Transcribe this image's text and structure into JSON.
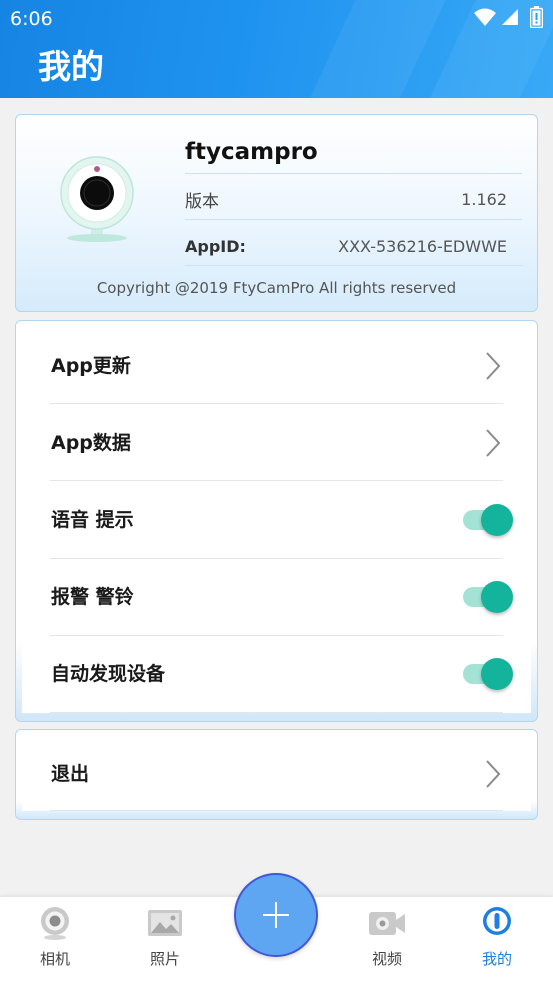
{
  "status_bar": {
    "time": "6:06",
    "icons": [
      "wifi-icon",
      "signal-icon",
      "battery-icon"
    ]
  },
  "header": {
    "title": "我的"
  },
  "app_info": {
    "logo_icon": "webcam-icon",
    "app_name": "ftycampro",
    "version_label": "版本",
    "version_value": "1.162",
    "appid_label": "AppID:",
    "appid_value": "XXX-536216-EDWWE",
    "copyright": "Copyright @2019 FtyCamPro All rights reserved"
  },
  "settings": {
    "items": [
      {
        "label": "App更新",
        "icon": "chevron-right-icon"
      },
      {
        "label": "App数据",
        "icon": "chevron-right-icon"
      },
      {
        "label": "语音 提示",
        "toggle_on": true
      },
      {
        "label": "报警 警铃",
        "toggle_on": true
      },
      {
        "label": "自动发现设备",
        "toggle_on": true
      }
    ]
  },
  "logout": {
    "label": "退出",
    "icon": "chevron-right-icon"
  },
  "bottom_nav": {
    "fab_icon": "plus-icon",
    "items": [
      {
        "label": "相机",
        "icon": "camera-tab-icon",
        "active": false
      },
      {
        "label": "照片",
        "icon": "photo-icon",
        "active": false
      },
      {
        "label": "视频",
        "icon": "video-icon",
        "active": false
      },
      {
        "label": "我的",
        "icon": "profile-icon",
        "active": true
      }
    ]
  },
  "colors": {
    "header-start": "#1684e3",
    "header-end": "#38a9f6",
    "accent": "#1e7fe0",
    "toggle-on": "#14b39b",
    "toggle-track": "#a3e2d5",
    "fab": "#5ea5f2",
    "card-border": "#b1d7f3",
    "bg": "#f1f1f1"
  }
}
